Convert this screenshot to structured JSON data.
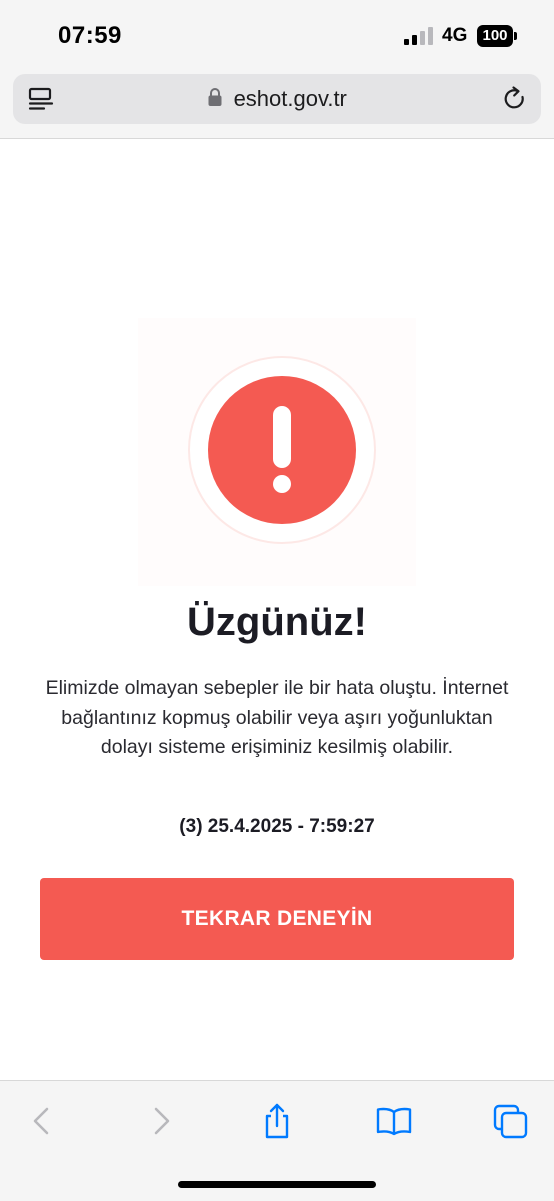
{
  "status_bar": {
    "time": "07:59",
    "network": "4G",
    "battery": "100"
  },
  "browser": {
    "url": "eshot.gov.tr"
  },
  "error": {
    "heading": "Üzgünüz!",
    "message": "Elimizde olmayan sebepler ile bir hata oluştu. İnternet bağlantınız kopmuş olabilir veya aşırı yoğunluktan dolayı sisteme erişiminiz kesilmiş olabilir.",
    "code": "(3) 25.4.2025 - 7:59:27",
    "retry_label": "TEKRAR DENEYİN"
  },
  "icons": {
    "reader": "reader-mode-icon",
    "lock": "lock-icon",
    "reload": "reload-icon",
    "back": "back-icon",
    "forward": "forward-icon",
    "share": "share-icon",
    "bookmarks": "bookmarks-icon",
    "tabs": "tabs-icon",
    "alert": "alert-icon"
  },
  "colors": {
    "accent": "#f45a52",
    "ios_blue": "#007aff",
    "disabled_gray": "#b8b8bc"
  }
}
